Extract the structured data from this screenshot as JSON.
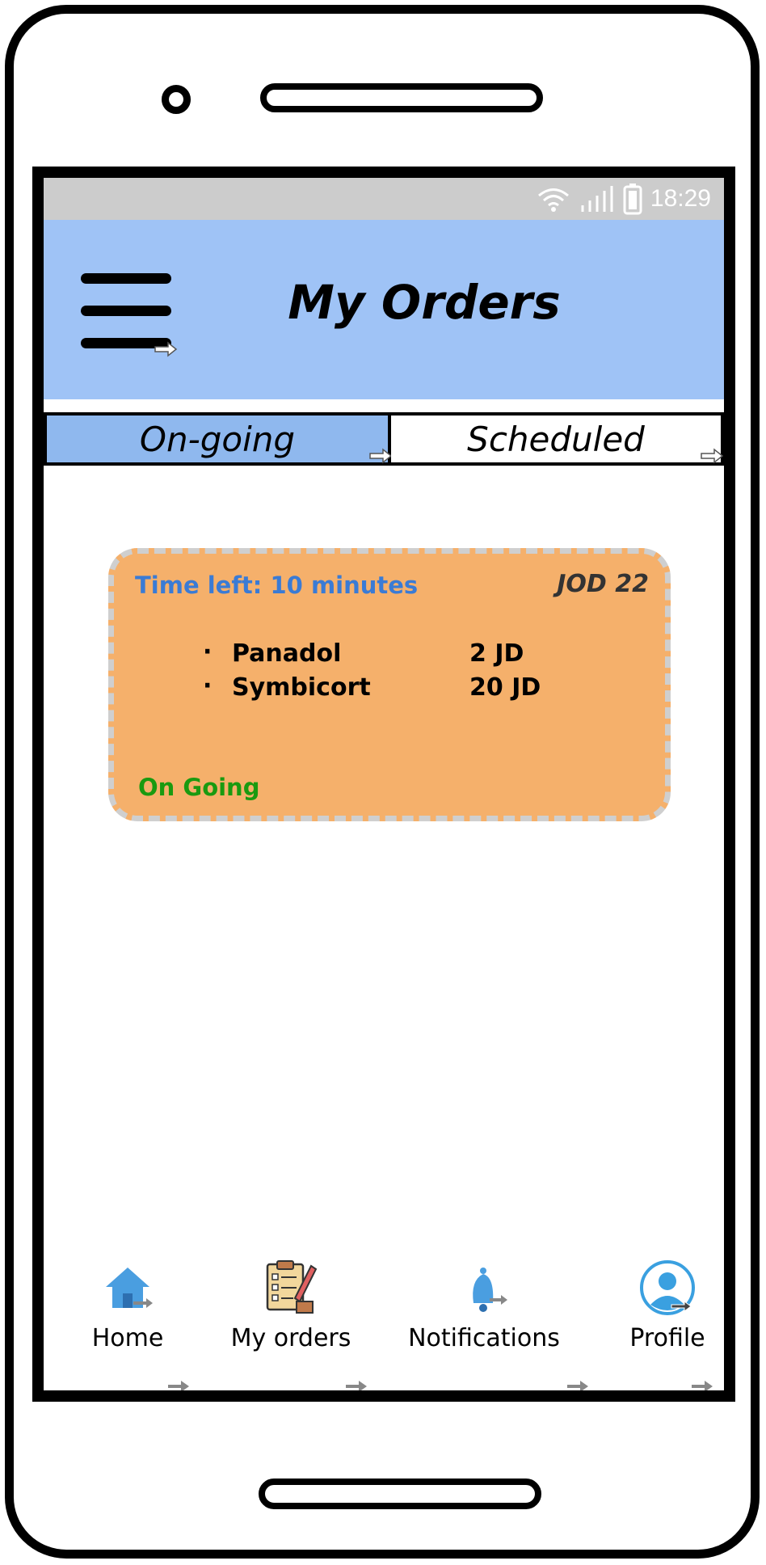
{
  "status_bar": {
    "time": "18:29",
    "icons": [
      "wifi-icon",
      "signal-icon",
      "battery-icon"
    ]
  },
  "app_bar": {
    "title": "My Orders",
    "menu_icon": "hamburger-menu-icon",
    "background": "#9fc3f6"
  },
  "tabs": [
    {
      "label": "On-going",
      "selected": true
    },
    {
      "label": "Scheduled",
      "selected": false
    }
  ],
  "order_card": {
    "time_left": "Time left: 10 minutes",
    "total": "JOD 22",
    "items": [
      {
        "name": "Panadol",
        "price": "2 JD"
      },
      {
        "name": "Symbicort",
        "price": "20 JD"
      }
    ],
    "status": "On Going",
    "background": "#f5b06b",
    "status_color": "#1a9a10",
    "time_color": "#3a7bd5"
  },
  "bottom_nav": [
    {
      "label": "Home",
      "icon": "home-icon"
    },
    {
      "label": "My orders",
      "icon": "clipboard-orders-icon"
    },
    {
      "label": "Notifications",
      "icon": "bell-icon"
    },
    {
      "label": "Profile",
      "icon": "user-profile-icon"
    }
  ]
}
